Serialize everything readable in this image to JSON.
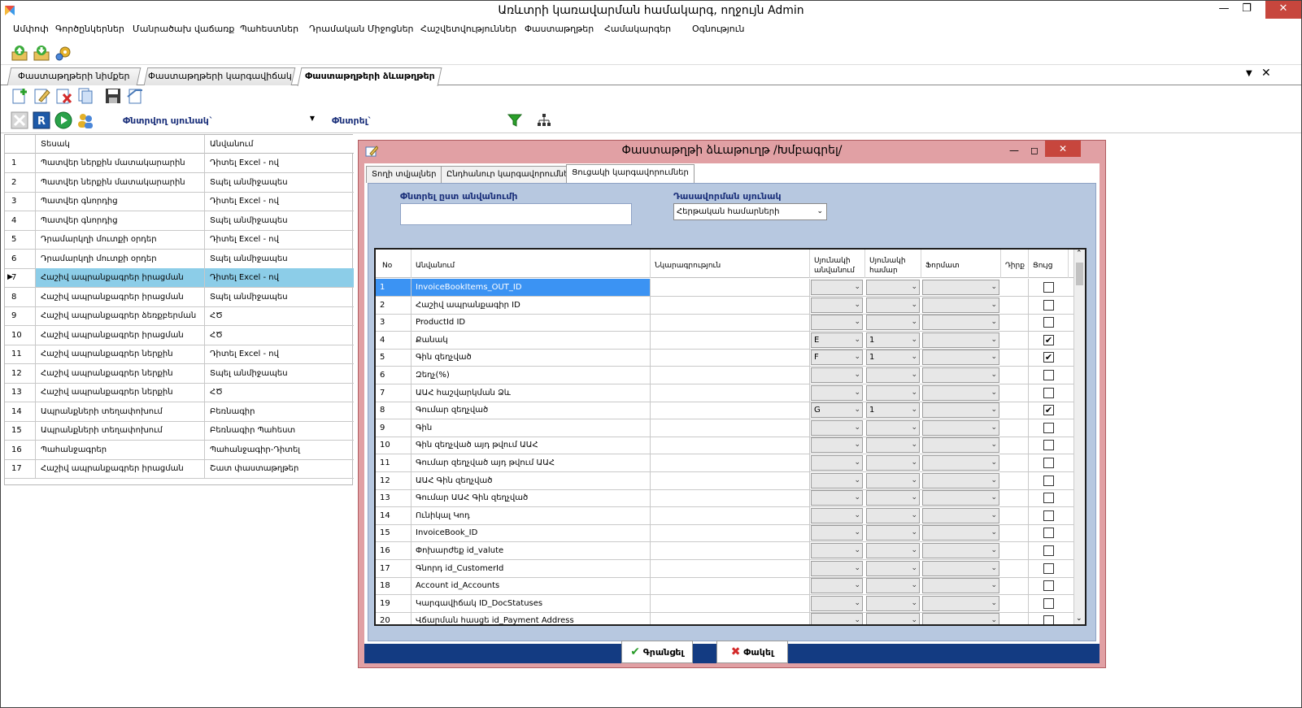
{
  "window": {
    "title": "Առևտրի կառավարման համակարգ, ողջույն Admin"
  },
  "menu": [
    "Ամփոփ",
    "Գործընկերներ",
    "Մանրածախ վաճառք",
    "Պահեստներ",
    "Դրամական Միջոցներ",
    "Հաշվետվություններ",
    "Փաստաթղթեր",
    "Համակարգեր",
    "Օգնություն"
  ],
  "tabs": [
    {
      "label": "Փաստաթղթերի նիմքեր"
    },
    {
      "label": "Փաստաթղթերի կարգավիճակ"
    },
    {
      "label": "Փաստաթղթերի ձևաթղթեր",
      "active": true
    }
  ],
  "filter": {
    "column_label": "Փնտրվող սյունակ`",
    "search_label": "Փնտրել`"
  },
  "left_grid": {
    "headers": [
      "Տեսակ",
      "Անվանում"
    ],
    "selected_index": 6,
    "rows": [
      {
        "no": "1",
        "type": "Պատվեր ներքին մատակարարին",
        "name": "Դիտել Excel - ով"
      },
      {
        "no": "2",
        "type": "Պատվեր ներքին մատակարարին",
        "name": "Տպել անմիջապես"
      },
      {
        "no": "3",
        "type": "Պատվեր գնորդից",
        "name": "Դիտել Excel - ով"
      },
      {
        "no": "4",
        "type": "Պատվեր գնորդից",
        "name": "Տպել անմիջապես"
      },
      {
        "no": "5",
        "type": "Դրամարկղի մուտքի օրդեր",
        "name": "Դիտել Excel - ով"
      },
      {
        "no": "6",
        "type": "Դրամարկղի մուտքի օրդեր",
        "name": "Տպել անմիջապես"
      },
      {
        "no": "7",
        "type": "Հաշիվ ապրանքագրեր իրացման",
        "name": "Դիտել Excel - ով"
      },
      {
        "no": "8",
        "type": "Հաշիվ ապրանքագրեր իրացման",
        "name": "Տպել անմիջապես"
      },
      {
        "no": "9",
        "type": "Հաշիվ ապրանքագրեր ձեռքբերման",
        "name": "ՀԾ"
      },
      {
        "no": "10",
        "type": "Հաշիվ ապրանքագրեր իրացման",
        "name": "ՀԾ"
      },
      {
        "no": "11",
        "type": "Հաշիվ ապրանքագրեր ներքին",
        "name": "Դիտել Excel - ով"
      },
      {
        "no": "12",
        "type": "Հաշիվ ապրանքագրեր ներքին",
        "name": "Տպել անմիջապես"
      },
      {
        "no": "13",
        "type": "Հաշիվ ապրանքագրեր ներքին",
        "name": "ՀԾ"
      },
      {
        "no": "14",
        "type": "Ապրանքների տեղափոխում",
        "name": "Բեռնագիր"
      },
      {
        "no": "15",
        "type": "Ապրանքների տեղափոխում",
        "name": "Բեռնագիր Պահեստ"
      },
      {
        "no": "16",
        "type": "Պահանջագրեր",
        "name": "Պահանջագիր-Դիտել"
      },
      {
        "no": "17",
        "type": "Հաշիվ ապրանքագրեր իրացման",
        "name": "Շատ փաստաթղթեր"
      }
    ]
  },
  "dialog": {
    "title": "Փաստաթղթի ձևաթուղթ /Խմբագրել/",
    "tabs": [
      "Տողի տվյալներ",
      "Ընդհանուր կարգավորումներ",
      "Ցուցակի կարգավորումներ"
    ],
    "active_tab": 2,
    "search_label": "Փնտրել ըստ անվանումի",
    "search_value": "",
    "sort_label": "Դասավորման սյունակ",
    "sort_value": "Հերթական համարների",
    "grid": {
      "headers": [
        "No",
        "Անվանում",
        "Նկարագրություն",
        "Սյունակի անվանում",
        "Սյունակի համար",
        "Ֆորմատ",
        "Դիրք",
        "Ցույց"
      ],
      "rows": [
        {
          "no": "1",
          "name": "InvoiceBookItems_OUT_ID",
          "col": "",
          "num": "",
          "checked": false
        },
        {
          "no": "2",
          "name": "Հաշիվ ապրանքագիր ID",
          "col": "",
          "num": "",
          "checked": false
        },
        {
          "no": "3",
          "name": "ProductId ID",
          "col": "",
          "num": "",
          "checked": false
        },
        {
          "no": "4",
          "name": "Քանակ",
          "col": "E",
          "num": "1",
          "checked": true
        },
        {
          "no": "5",
          "name": "Գին զեղչված",
          "col": "F",
          "num": "1",
          "checked": true
        },
        {
          "no": "6",
          "name": "Զեղչ(%)",
          "col": "",
          "num": "",
          "checked": false
        },
        {
          "no": "7",
          "name": "ԱԱՀ հաշվարկման Ձև",
          "col": "",
          "num": "",
          "checked": false
        },
        {
          "no": "8",
          "name": "Գումար զեղչված",
          "col": "G",
          "num": "1",
          "checked": true
        },
        {
          "no": "9",
          "name": "Գին",
          "col": "",
          "num": "",
          "checked": false
        },
        {
          "no": "10",
          "name": "Գին զեղչված այդ թվում ԱԱՀ",
          "col": "",
          "num": "",
          "checked": false
        },
        {
          "no": "11",
          "name": "Գումար զեղչված այդ թվում ԱԱՀ",
          "col": "",
          "num": "",
          "checked": false
        },
        {
          "no": "12",
          "name": "ԱԱՀ Գին զեղչված",
          "col": "",
          "num": "",
          "checked": false
        },
        {
          "no": "13",
          "name": "Գումար ԱԱՀ Գին զեղչված",
          "col": "",
          "num": "",
          "checked": false
        },
        {
          "no": "14",
          "name": "Ունիկալ Կոդ",
          "col": "",
          "num": "",
          "checked": false
        },
        {
          "no": "15",
          "name": "InvoiceBook_ID",
          "col": "",
          "num": "",
          "checked": false
        },
        {
          "no": "16",
          "name": "Փոխարժեք id_valute",
          "col": "",
          "num": "",
          "checked": false
        },
        {
          "no": "17",
          "name": "Գնորդ id_CustomerId",
          "col": "",
          "num": "",
          "checked": false
        },
        {
          "no": "18",
          "name": "Account id_Accounts",
          "col": "",
          "num": "",
          "checked": false
        },
        {
          "no": "19",
          "name": "Կարգավիճակ ID_DocStatuses",
          "col": "",
          "num": "",
          "checked": false
        },
        {
          "no": "20",
          "name": "Վճարման հասցե id_Payment Address",
          "col": "",
          "num": "",
          "checked": false
        }
      ]
    },
    "ok_label": "Գրանցել",
    "cancel_label": "Փակել"
  }
}
